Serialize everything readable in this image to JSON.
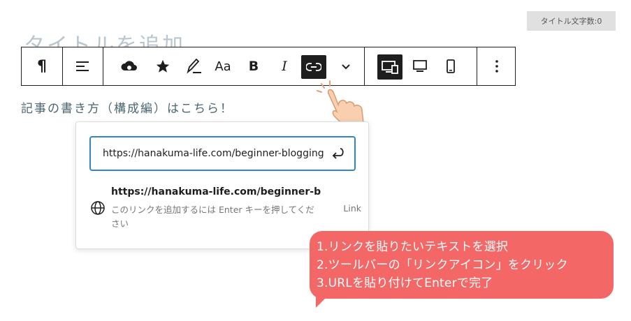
{
  "counter": {
    "label": "タイトル文字数:0"
  },
  "title": {
    "placeholder": "タイトルを追加"
  },
  "toolbar": {
    "items": [
      {
        "name": "paragraph",
        "icon": "pilcrow-icon",
        "glyph": "¶"
      },
      {
        "name": "align",
        "icon": "align-left-icon"
      },
      {
        "name": "cloud",
        "icon": "cloud-icon"
      },
      {
        "name": "star",
        "icon": "star-icon"
      },
      {
        "name": "highlight",
        "icon": "pen-icon"
      },
      {
        "name": "font-size",
        "icon": "font-size-icon",
        "glyph": "Aa"
      },
      {
        "name": "bold",
        "icon": "bold-icon",
        "glyph": "B"
      },
      {
        "name": "italic",
        "icon": "italic-icon",
        "glyph": "I"
      },
      {
        "name": "link",
        "icon": "link-icon",
        "active": true
      },
      {
        "name": "more-formats",
        "icon": "chevron-down-icon"
      },
      {
        "name": "desktop-mobile",
        "icon": "desktop-mobile-icon",
        "active": true
      },
      {
        "name": "desktop",
        "icon": "desktop-icon"
      },
      {
        "name": "mobile",
        "icon": "mobile-icon"
      },
      {
        "name": "options",
        "icon": "more-vertical-icon"
      }
    ]
  },
  "content": {
    "text": "記事の書き方（構成編）はこちら！"
  },
  "link_popover": {
    "input_value": "https://hanakuma-life.com/beginner-blogging",
    "suggestion": {
      "title": "https://hanakuma-life.com/beginner-bl...",
      "description": "このリンクを追加するには Enter キーを押してください",
      "type": "Link"
    }
  },
  "callout": {
    "lines": [
      "1.リンクを貼りたいテキストを選択",
      "2.ツールバーの「リンクアイコン」をクリック",
      "3.URLを貼り付けてEnterで完了"
    ],
    "color": "#f46767"
  },
  "colors": {
    "accent": "#3582c4",
    "dark": "#1e1e1e"
  }
}
